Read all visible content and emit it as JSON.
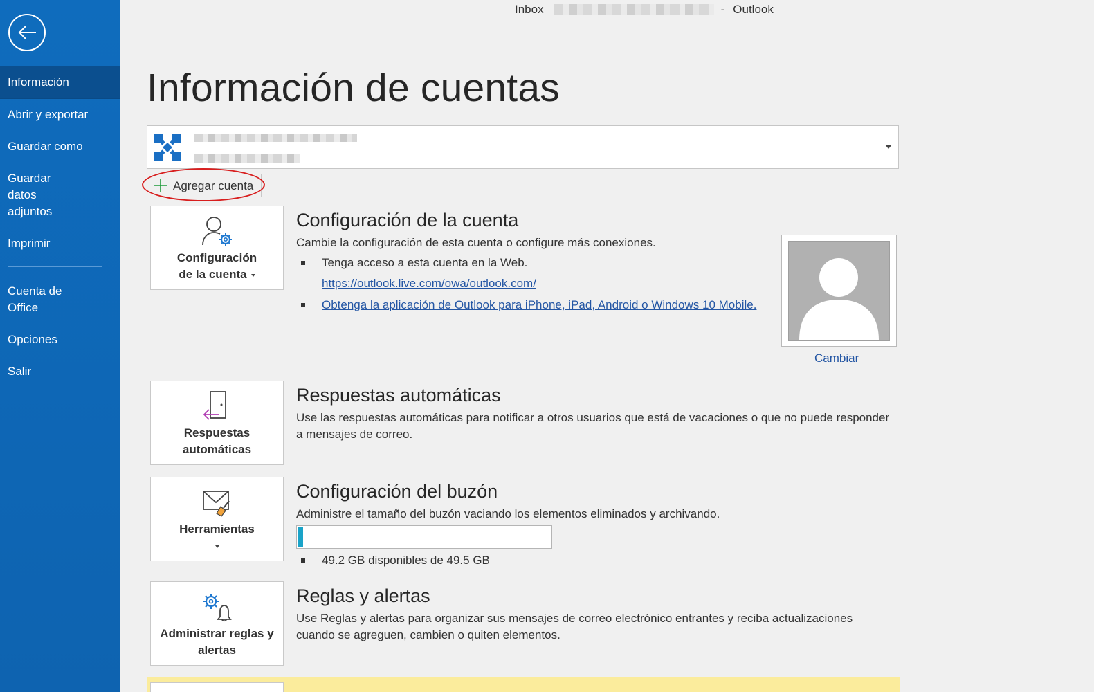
{
  "window": {
    "title_left": "Inbox",
    "title_separator": "-",
    "title_right": "Outlook"
  },
  "sidebar": {
    "items": [
      {
        "label": "Información",
        "active": true
      },
      {
        "label": "Abrir y exportar"
      },
      {
        "label": "Guardar como"
      },
      {
        "label": "Guardar datos adjuntos"
      },
      {
        "label": "Imprimir"
      },
      {
        "label": "Cuenta de Office"
      },
      {
        "label": "Opciones"
      },
      {
        "label": "Salir"
      }
    ]
  },
  "page": {
    "title": "Información de cuentas",
    "add_account_label": "Agregar cuenta"
  },
  "sections": {
    "account_settings": {
      "tile_label_line1": "Configuración",
      "tile_label_line2": "de la cuenta",
      "title": "Configuración de la cuenta",
      "description": "Cambie la configuración de esta cuenta o configure más conexiones.",
      "bullet1": "Tenga acceso a esta cuenta en la Web.",
      "web_link": "https://outlook.live.com/owa/outlook.com/",
      "app_link": "Obtenga la aplicación de Outlook para iPhone, iPad, Android o Windows 10 Mobile.",
      "change_photo_label": "Cambiar"
    },
    "auto_replies": {
      "tile_label_line1": "Respuestas",
      "tile_label_line2": "automáticas",
      "title": "Respuestas automáticas",
      "description": "Use las respuestas automáticas para notificar a otros usuarios que está de vacaciones o que no puede responder a mensajes de correo."
    },
    "mailbox": {
      "tile_label": "Herramientas",
      "title": "Configuración del buzón",
      "description": "Administre el tamaño del buzón vaciando los elementos eliminados y archivando.",
      "quota_text": "49.2 GB disponibles de 49.5 GB",
      "quota_used_fraction": 0.006
    },
    "rules": {
      "tile_label_line1": "Administrar reglas y",
      "tile_label_line2": "alertas",
      "title": "Reglas y alertas",
      "description": "Use Reglas y alertas para organizar sus mensajes de correo electrónico entrantes y reciba actualizaciones cuando se agreguen, cambien o quiten elementos."
    }
  },
  "colors": {
    "sidebar_bg": "#0f6cbd",
    "sidebar_active": "#0b4f8f",
    "link": "#2456a4",
    "highlight_ellipse": "#d81e1e",
    "quota_fill": "#1aa3c8",
    "exchange_logo": "#1a6fc4"
  },
  "icons": {
    "back": "back-arrow-icon",
    "account": "exchange-logo-icon",
    "add": "plus-icon",
    "account_settings": "user-gear-icon",
    "auto_replies": "door-arrow-icon",
    "mailbox": "envelope-broom-icon",
    "rules": "gear-bell-icon",
    "avatar": "default-avatar-icon"
  }
}
